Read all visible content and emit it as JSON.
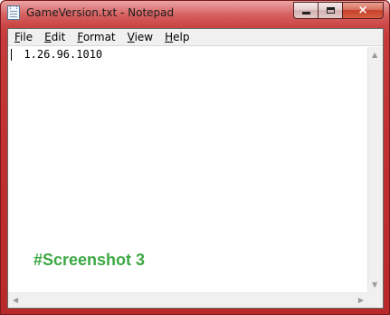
{
  "window": {
    "title": "GameVersion.txt - Notepad",
    "close_glyph": "×",
    "colors": {
      "frame": "#c53a3a",
      "close_button": "#c6402a"
    }
  },
  "menu": {
    "items": [
      {
        "underline": "F",
        "rest": "ile"
      },
      {
        "underline": "E",
        "rest": "dit"
      },
      {
        "underline": "F",
        "rest": "ormat"
      },
      {
        "underline": "V",
        "rest": "iew"
      },
      {
        "underline": "H",
        "rest": "elp"
      }
    ]
  },
  "editor": {
    "content": "  1.26.96.1010"
  },
  "overlay": {
    "label": "#Screenshot 3",
    "color": "#3ca844"
  },
  "scrollbars": {
    "up_arrow": "▲",
    "down_arrow": "▼",
    "left_arrow": "◀",
    "right_arrow": "▶"
  },
  "icons": [
    "notepad-icon",
    "minimize-icon",
    "maximize-icon",
    "close-icon"
  ]
}
